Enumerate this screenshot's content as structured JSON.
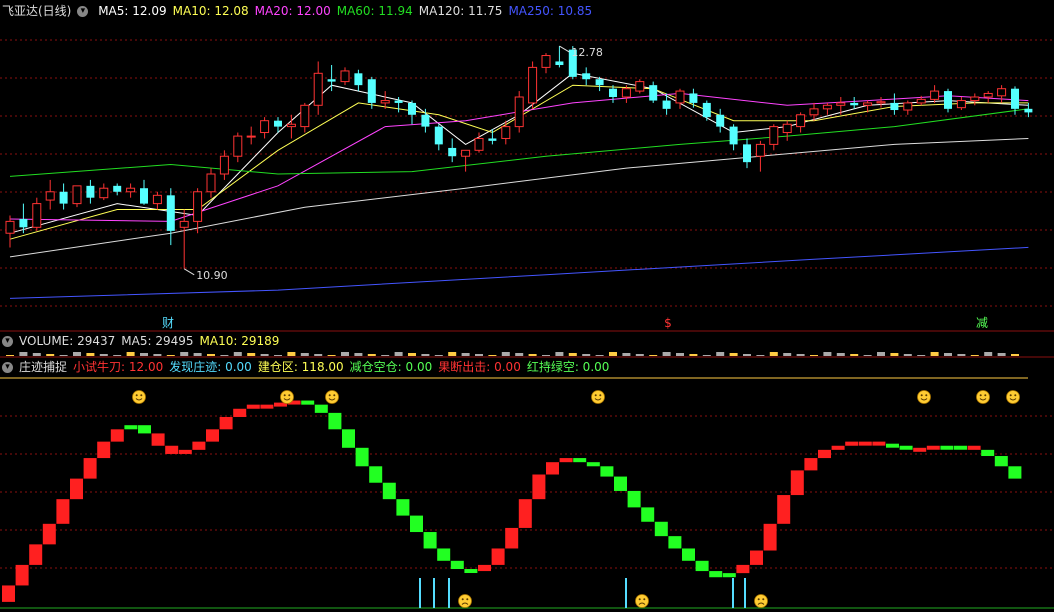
{
  "main_chart": {
    "title": "飞亚达(日线)",
    "ma_legend": [
      {
        "label": "MA5: 12.09",
        "color": "#ffffff"
      },
      {
        "label": "MA10: 12.08",
        "color": "#ffff55"
      },
      {
        "label": "MA20: 12.00",
        "color": "#ff44ff"
      },
      {
        "label": "MA60: 11.94",
        "color": "#22dd22"
      },
      {
        "label": "MA120: 11.75",
        "color": "#dddddd"
      },
      {
        "label": "MA250: 10.85",
        "color": "#4455ff"
      }
    ],
    "high_label": "12.78",
    "low_label": "10.90",
    "markers": [
      {
        "text": "财",
        "color": "#55ddff"
      },
      {
        "text": "$",
        "color": "#ff3333"
      },
      {
        "text": "减",
        "color": "#55ff55"
      }
    ]
  },
  "volume_panel": {
    "legend": [
      {
        "label": "VOLUME: 29437",
        "color": "#dddddd"
      },
      {
        "label": "MA5: 29495",
        "color": "#dddddd"
      },
      {
        "label": "MA10: 29189",
        "color": "#ffff55"
      }
    ]
  },
  "indicator_panel": {
    "title": "庄迹捕捉",
    "legend": [
      {
        "label": "小试牛刀: 12.00",
        "color": "#ff3333"
      },
      {
        "label": "发现庄迹: 0.00",
        "color": "#55ddff"
      },
      {
        "label": "建仓区: 118.00",
        "color": "#ffff55"
      },
      {
        "label": "减仓空仓: 0.00",
        "color": "#55ff55"
      },
      {
        "label": "果断出击: 0.00",
        "color": "#ff3333"
      },
      {
        "label": "红持绿空: 0.00",
        "color": "#55ff55"
      }
    ]
  },
  "colors": {
    "up": "#ff3333",
    "down": "#55ffff",
    "red_block": "#ff2020",
    "green_block": "#22ff22",
    "grid": "#8a1010"
  },
  "chart_data": {
    "type": "candlestick",
    "candles": [
      [
        11.2,
        11.35,
        11.08,
        11.3
      ],
      [
        11.32,
        11.45,
        11.2,
        11.25
      ],
      [
        11.25,
        11.5,
        11.22,
        11.45
      ],
      [
        11.48,
        11.65,
        11.4,
        11.55
      ],
      [
        11.55,
        11.62,
        11.4,
        11.45
      ],
      [
        11.45,
        11.6,
        11.42,
        11.6
      ],
      [
        11.6,
        11.65,
        11.45,
        11.5
      ],
      [
        11.5,
        11.62,
        11.48,
        11.58
      ],
      [
        11.6,
        11.62,
        11.52,
        11.55
      ],
      [
        11.55,
        11.62,
        11.5,
        11.58
      ],
      [
        11.58,
        11.65,
        11.44,
        11.45
      ],
      [
        11.45,
        11.55,
        11.4,
        11.52
      ],
      [
        11.52,
        11.58,
        11.1,
        11.22
      ],
      [
        11.25,
        11.4,
        10.9,
        11.3
      ],
      [
        11.3,
        11.58,
        11.2,
        11.55
      ],
      [
        11.55,
        11.75,
        11.5,
        11.7
      ],
      [
        11.7,
        11.9,
        11.65,
        11.85
      ],
      [
        11.85,
        12.05,
        11.8,
        12.02
      ],
      [
        12.02,
        12.1,
        11.95,
        12.02
      ],
      [
        12.05,
        12.18,
        12.0,
        12.15
      ],
      [
        12.15,
        12.18,
        12.05,
        12.1
      ],
      [
        12.1,
        12.2,
        12.0,
        12.12
      ],
      [
        12.1,
        12.3,
        12.05,
        12.28
      ],
      [
        12.28,
        12.65,
        12.2,
        12.55
      ],
      [
        12.5,
        12.62,
        12.4,
        12.48
      ],
      [
        12.48,
        12.6,
        12.45,
        12.57
      ],
      [
        12.55,
        12.58,
        12.4,
        12.45
      ],
      [
        12.5,
        12.52,
        12.25,
        12.3
      ],
      [
        12.3,
        12.4,
        12.25,
        12.32
      ],
      [
        12.32,
        12.35,
        12.22,
        12.3
      ],
      [
        12.3,
        12.32,
        12.12,
        12.2
      ],
      [
        12.2,
        12.25,
        12.05,
        12.1
      ],
      [
        12.1,
        12.12,
        11.9,
        11.95
      ],
      [
        11.92,
        12.0,
        11.8,
        11.85
      ],
      [
        11.85,
        11.9,
        11.72,
        11.9
      ],
      [
        11.9,
        12.05,
        11.88,
        12.0
      ],
      [
        12.0,
        12.08,
        11.95,
        11.98
      ],
      [
        12.0,
        12.15,
        11.95,
        12.1
      ],
      [
        12.1,
        12.4,
        12.05,
        12.35
      ],
      [
        12.3,
        12.65,
        12.25,
        12.6
      ],
      [
        12.6,
        12.72,
        12.55,
        12.7
      ],
      [
        12.65,
        12.78,
        12.6,
        12.62
      ],
      [
        12.75,
        12.78,
        12.5,
        12.52
      ],
      [
        12.55,
        12.6,
        12.45,
        12.5
      ],
      [
        12.5,
        12.52,
        12.4,
        12.45
      ],
      [
        12.42,
        12.45,
        12.3,
        12.35
      ],
      [
        12.35,
        12.45,
        12.3,
        12.42
      ],
      [
        12.4,
        12.5,
        12.38,
        12.48
      ],
      [
        12.45,
        12.48,
        12.3,
        12.32
      ],
      [
        12.32,
        12.38,
        12.2,
        12.25
      ],
      [
        12.3,
        12.42,
        12.25,
        12.4
      ],
      [
        12.38,
        12.42,
        12.26,
        12.3
      ],
      [
        12.3,
        12.32,
        12.15,
        12.18
      ],
      [
        12.2,
        12.25,
        12.05,
        12.1
      ],
      [
        12.1,
        12.12,
        11.9,
        11.95
      ],
      [
        11.95,
        12.0,
        11.75,
        11.8
      ],
      [
        11.85,
        11.98,
        11.72,
        11.95
      ],
      [
        11.95,
        12.12,
        11.9,
        12.1
      ],
      [
        12.05,
        12.15,
        11.98,
        12.12
      ],
      [
        12.1,
        12.22,
        12.05,
        12.2
      ],
      [
        12.2,
        12.3,
        12.15,
        12.25
      ],
      [
        12.25,
        12.3,
        12.2,
        12.28
      ],
      [
        12.28,
        12.35,
        12.2,
        12.3
      ],
      [
        12.3,
        12.35,
        12.25,
        12.28
      ],
      [
        12.28,
        12.32,
        12.22,
        12.3
      ],
      [
        12.3,
        12.35,
        12.26,
        12.31
      ],
      [
        12.3,
        12.38,
        12.2,
        12.24
      ],
      [
        12.24,
        12.32,
        12.2,
        12.3
      ],
      [
        12.3,
        12.36,
        12.28,
        12.33
      ],
      [
        12.33,
        12.45,
        12.3,
        12.4
      ],
      [
        12.4,
        12.42,
        12.22,
        12.25
      ],
      [
        12.26,
        12.35,
        12.24,
        12.32
      ],
      [
        12.32,
        12.38,
        12.28,
        12.35
      ],
      [
        12.35,
        12.4,
        12.3,
        12.38
      ],
      [
        12.36,
        12.45,
        12.3,
        12.42
      ],
      [
        12.42,
        12.44,
        12.2,
        12.25
      ],
      [
        12.25,
        12.3,
        12.18,
        12.22
      ]
    ],
    "ylim": [
      10.4,
      13.0
    ],
    "ma_series": [
      {
        "name": "MA5",
        "color": "#ffffff",
        "points": [
          [
            0,
            11.2
          ],
          [
            8,
            11.45
          ],
          [
            14,
            11.35
          ],
          [
            20,
            12.05
          ],
          [
            24,
            12.45
          ],
          [
            30,
            12.3
          ],
          [
            34,
            11.95
          ],
          [
            38,
            12.2
          ],
          [
            42,
            12.55
          ],
          [
            48,
            12.42
          ],
          [
            54,
            12.05
          ],
          [
            58,
            12.1
          ],
          [
            64,
            12.28
          ],
          [
            70,
            12.32
          ],
          [
            76,
            12.28
          ]
        ]
      },
      {
        "name": "MA10",
        "color": "#ffff55",
        "points": [
          [
            0,
            11.15
          ],
          [
            8,
            11.4
          ],
          [
            14,
            11.4
          ],
          [
            20,
            11.9
          ],
          [
            26,
            12.3
          ],
          [
            32,
            12.2
          ],
          [
            36,
            12.05
          ],
          [
            42,
            12.45
          ],
          [
            48,
            12.42
          ],
          [
            54,
            12.15
          ],
          [
            60,
            12.15
          ],
          [
            66,
            12.27
          ],
          [
            72,
            12.3
          ],
          [
            76,
            12.3
          ]
        ]
      },
      {
        "name": "MA20",
        "color": "#ff44ff",
        "points": [
          [
            0,
            11.32
          ],
          [
            12,
            11.3
          ],
          [
            20,
            11.6
          ],
          [
            28,
            12.1
          ],
          [
            34,
            12.15
          ],
          [
            42,
            12.3
          ],
          [
            50,
            12.38
          ],
          [
            58,
            12.28
          ],
          [
            64,
            12.32
          ],
          [
            70,
            12.36
          ],
          [
            76,
            12.32
          ]
        ]
      },
      {
        "name": "MA60",
        "color": "#22dd22",
        "points": [
          [
            0,
            11.68
          ],
          [
            12,
            11.78
          ],
          [
            20,
            11.7
          ],
          [
            30,
            11.72
          ],
          [
            40,
            11.85
          ],
          [
            50,
            11.95
          ],
          [
            58,
            12.02
          ],
          [
            66,
            12.1
          ],
          [
            76,
            12.25
          ]
        ]
      },
      {
        "name": "MA120",
        "color": "#dddddd",
        "points": [
          [
            0,
            11.0
          ],
          [
            12,
            11.2
          ],
          [
            22,
            11.42
          ],
          [
            34,
            11.58
          ],
          [
            46,
            11.75
          ],
          [
            56,
            11.85
          ],
          [
            66,
            11.95
          ],
          [
            76,
            12.0
          ]
        ]
      },
      {
        "name": "MA250",
        "color": "#4455ff",
        "points": [
          [
            0,
            10.65
          ],
          [
            20,
            10.72
          ],
          [
            40,
            10.85
          ],
          [
            60,
            10.98
          ],
          [
            76,
            11.08
          ]
        ]
      }
    ],
    "indicator_blocks": [
      [
        0,
        "r"
      ],
      [
        1,
        "r"
      ],
      [
        2,
        "r"
      ],
      [
        3,
        "r"
      ],
      [
        4,
        "r"
      ],
      [
        5,
        "r"
      ],
      [
        6,
        "r"
      ],
      [
        7,
        "r"
      ],
      [
        8,
        "r"
      ],
      [
        9,
        "g"
      ],
      [
        10,
        "g"
      ],
      [
        11,
        "r"
      ],
      [
        12,
        "r"
      ],
      [
        13,
        "r"
      ],
      [
        14,
        "r"
      ],
      [
        15,
        "r"
      ],
      [
        16,
        "r"
      ],
      [
        17,
        "r"
      ],
      [
        18,
        "r"
      ],
      [
        19,
        "r"
      ],
      [
        20,
        "r"
      ],
      [
        21,
        "r"
      ],
      [
        22,
        "g"
      ],
      [
        23,
        "g"
      ],
      [
        24,
        "g"
      ],
      [
        25,
        "g"
      ],
      [
        26,
        "g"
      ],
      [
        27,
        "g"
      ],
      [
        28,
        "g"
      ],
      [
        29,
        "g"
      ],
      [
        30,
        "g"
      ],
      [
        31,
        "g"
      ],
      [
        32,
        "g"
      ],
      [
        33,
        "g"
      ],
      [
        34,
        "g"
      ],
      [
        35,
        "r"
      ],
      [
        36,
        "r"
      ],
      [
        37,
        "r"
      ],
      [
        38,
        "r"
      ],
      [
        39,
        "r"
      ],
      [
        40,
        "r"
      ],
      [
        41,
        "r"
      ],
      [
        42,
        "g"
      ],
      [
        43,
        "g"
      ],
      [
        44,
        "g"
      ],
      [
        45,
        "g"
      ],
      [
        46,
        "g"
      ],
      [
        47,
        "g"
      ],
      [
        48,
        "g"
      ],
      [
        49,
        "g"
      ],
      [
        50,
        "g"
      ],
      [
        51,
        "g"
      ],
      [
        52,
        "g"
      ],
      [
        53,
        "g"
      ],
      [
        54,
        "r"
      ],
      [
        55,
        "r"
      ],
      [
        56,
        "r"
      ],
      [
        57,
        "r"
      ],
      [
        58,
        "r"
      ],
      [
        59,
        "r"
      ],
      [
        60,
        "r"
      ],
      [
        61,
        "r"
      ],
      [
        62,
        "r"
      ],
      [
        63,
        "r"
      ],
      [
        64,
        "r"
      ],
      [
        65,
        "g"
      ],
      [
        66,
        "g"
      ],
      [
        67,
        "r"
      ],
      [
        68,
        "r"
      ],
      [
        69,
        "g"
      ],
      [
        70,
        "g"
      ],
      [
        71,
        "r"
      ],
      [
        72,
        "g"
      ],
      [
        73,
        "g"
      ],
      [
        74,
        "g"
      ]
    ],
    "indicator_values": [
      10,
      20,
      30,
      40,
      52,
      62,
      72,
      80,
      86,
      88,
      84,
      78,
      74,
      76,
      80,
      86,
      92,
      96,
      98,
      98,
      99,
      100,
      98,
      94,
      86,
      77,
      68,
      60,
      52,
      44,
      36,
      28,
      22,
      18,
      17,
      20,
      28,
      38,
      52,
      64,
      70,
      72,
      70,
      68,
      63,
      56,
      48,
      41,
      34,
      28,
      22,
      17,
      14,
      16,
      20,
      27,
      40,
      54,
      66,
      72,
      76,
      78,
      80,
      80,
      79,
      78,
      77,
      77,
      78,
      78,
      78,
      76,
      73,
      68,
      62
    ],
    "indicator_ylim": [
      0,
      110
    ]
  }
}
